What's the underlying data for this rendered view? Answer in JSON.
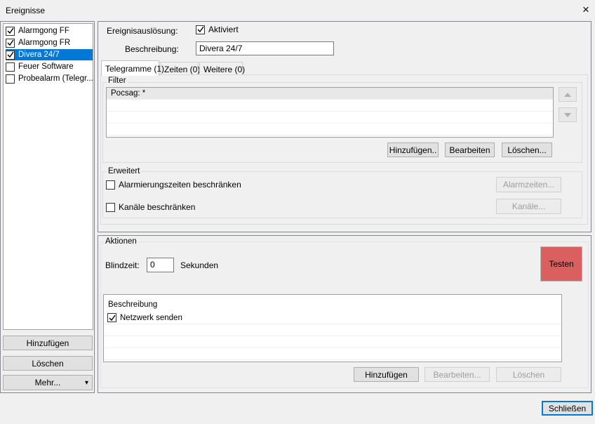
{
  "window": {
    "title": "Ereignisse",
    "close_label": "×"
  },
  "events": [
    {
      "label": "Alarmgong FF",
      "checked": true,
      "selected": false
    },
    {
      "label": "Alarmgong FR",
      "checked": true,
      "selected": false
    },
    {
      "label": "Divera 24/7",
      "checked": true,
      "selected": true
    },
    {
      "label": "Feuer Software",
      "checked": false,
      "selected": false
    },
    {
      "label": "Probealarm (Telegr...",
      "checked": false,
      "selected": false
    }
  ],
  "left_buttons": {
    "add": "Hinzufügen",
    "delete": "Löschen",
    "more": "Mehr...",
    "more_arrow": "▾"
  },
  "trigger": {
    "label": "Ereignisauslösung:",
    "activated_label": "Aktiviert",
    "activated_checked": true,
    "description_label": "Beschreibung:",
    "description_value": "Divera 24/7"
  },
  "tabs": [
    {
      "label": "Telegramme (1)",
      "active": true
    },
    {
      "label": "Zeiten (0)",
      "active": false
    },
    {
      "label": "Weitere (0)",
      "active": false
    }
  ],
  "filter": {
    "group_label": "Filter",
    "rows": [
      "Pocsag:  *",
      "",
      "",
      ""
    ],
    "buttons": {
      "add": "Hinzufügen..",
      "edit": "Bearbeiten",
      "delete": "Löschen..."
    }
  },
  "extended": {
    "group_label": "Erweitert",
    "restrict_times_label": "Alarmierungszeiten beschränken",
    "restrict_times_checked": false,
    "restrict_channels_label": "Kanäle beschränken",
    "restrict_channels_checked": false,
    "times_button": "Alarmzeiten...",
    "channels_button": "Kanäle..."
  },
  "actions": {
    "group_label": "Aktionen",
    "blind_time_label": "Blindzeit:",
    "blind_time_value": "0",
    "blind_time_unit": "Sekunden",
    "test_button": "Testen",
    "test_color": "#d9605e",
    "list_header": "Beschreibung",
    "items": [
      {
        "label": "Netzwerk senden",
        "checked": true
      }
    ],
    "buttons": {
      "add": "Hinzufügen",
      "edit": "Bearbeiten...",
      "delete": "Löschen"
    }
  },
  "footer": {
    "close": "Schließen"
  },
  "colors": {
    "selection": "#0078d7",
    "accent": "#0078d7"
  }
}
